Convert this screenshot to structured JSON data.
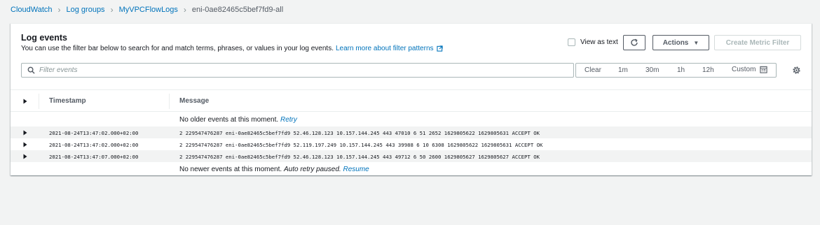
{
  "breadcrumb": {
    "items": [
      "CloudWatch",
      "Log groups",
      "MyVPCFlowLogs"
    ],
    "current": "eni-0ae82465c5bef7fd9-all"
  },
  "panel": {
    "title": "Log events",
    "description": "You can use the filter bar below to search for and match terms, phrases, or values in your log events.",
    "learn_more_link": "Learn more about filter patterns",
    "view_as_text_label": "View as text",
    "actions_label": "Actions",
    "create_metric_filter_label": "Create Metric Filter"
  },
  "filter": {
    "placeholder": "Filter events",
    "value": ""
  },
  "time_range": {
    "clear": "Clear",
    "options": [
      "1m",
      "30m",
      "1h",
      "12h"
    ],
    "custom": "Custom"
  },
  "table": {
    "columns": {
      "timestamp": "Timestamp",
      "message": "Message"
    },
    "older_notice": "No older events at this moment.",
    "older_link": "Retry",
    "rows": [
      {
        "timestamp": "2021-08-24T13:47:02.000+02:00",
        "message": "2 229547476287 eni-0ae82465c5bef7fd9 52.46.128.123 10.157.144.245 443 47010 6 51 2652 1629805622 1629805631 ACCEPT OK"
      },
      {
        "timestamp": "2021-08-24T13:47:02.000+02:00",
        "message": "2 229547476287 eni-0ae82465c5bef7fd9 52.119.197.249 10.157.144.245 443 39988 6 10 6308 1629805622 1629805631 ACCEPT OK"
      },
      {
        "timestamp": "2021-08-24T13:47:07.000+02:00",
        "message": "2 229547476287 eni-0ae82465c5bef7fd9 52.46.128.123 10.157.144.245 443 49712 6 50 2600 1629805627 1629805627 ACCEPT OK"
      }
    ],
    "newer_notice": "No newer events at this moment.",
    "newer_paused": "Auto retry paused.",
    "newer_link": "Resume"
  },
  "colors": {
    "link": "#0073bb",
    "background": "#f2f3f3",
    "border": "#aab7b8"
  },
  "icons": [
    "external-link-icon",
    "refresh-icon",
    "caret-down-icon",
    "search-icon",
    "calendar-icon",
    "settings-icon",
    "expand-icon"
  ]
}
